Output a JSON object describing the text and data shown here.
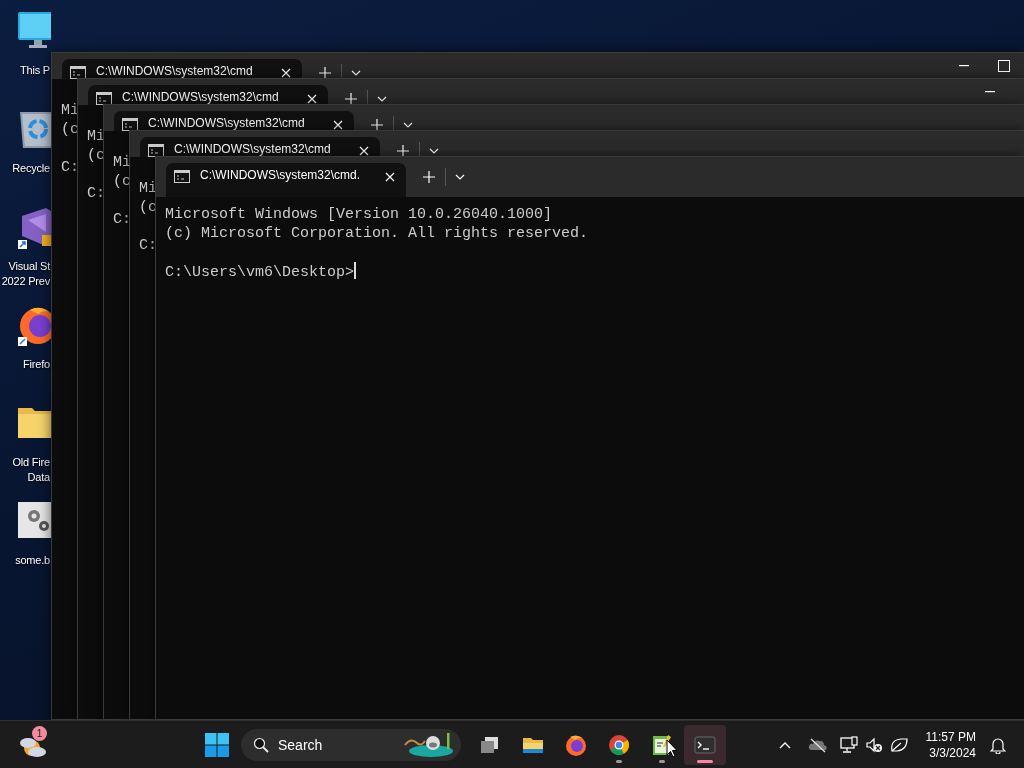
{
  "desktop": {
    "icons": [
      {
        "label_lines": [
          "This P"
        ]
      },
      {
        "label_lines": [
          "Recycle"
        ]
      },
      {
        "label_lines": [
          "Visual St",
          "2022 Prev"
        ]
      },
      {
        "label_lines": [
          "Firefo"
        ]
      },
      {
        "label_lines": [
          "Old Fire",
          "Data"
        ]
      },
      {
        "label_lines": [
          "some.b"
        ]
      }
    ]
  },
  "windows": [
    {
      "tab_title": "C:\\WINDOWS\\system32\\cmd",
      "lines": [
        "Mi",
        "(c"
      ],
      "prompt": "C:",
      "caption_buttons": [
        {
          "kind": "minimize"
        },
        {
          "kind": "maximize"
        }
      ]
    },
    {
      "tab_title": "C:\\WINDOWS\\system32\\cmd",
      "lines": [
        "Mi",
        "(c"
      ],
      "prompt": "C:",
      "caption_buttons": [
        {
          "kind": "minimize"
        }
      ]
    },
    {
      "tab_title": "C:\\WINDOWS\\system32\\cmd",
      "lines": [
        "Mi",
        "(c"
      ],
      "prompt": "C:"
    },
    {
      "tab_title": "C:\\WINDOWS\\system32\\cmd",
      "lines": [
        "Mi",
        "(c"
      ],
      "prompt": "C:"
    },
    {
      "tab_title": "C:\\WINDOWS\\system32\\cmd.",
      "lines": [
        "Microsoft Windows [Version 10.0.26040.1000]",
        "(c) Microsoft Corporation. All rights reserved."
      ],
      "prompt": "C:\\Users\\vm6\\Desktop>",
      "cursor": true
    }
  ],
  "taskbar": {
    "weather": {
      "badge": "1"
    },
    "search": {
      "placeholder": "Search"
    },
    "apps": [
      {
        "running": false,
        "selected": false
      },
      {
        "running": false,
        "selected": false
      },
      {
        "running": false,
        "selected": false
      },
      {
        "running": true,
        "selected": false
      },
      {
        "running": true,
        "selected": false
      },
      {
        "running": true,
        "selected": true
      }
    ],
    "clock": {
      "time": "11:57 PM",
      "date": "3/3/2024"
    }
  }
}
